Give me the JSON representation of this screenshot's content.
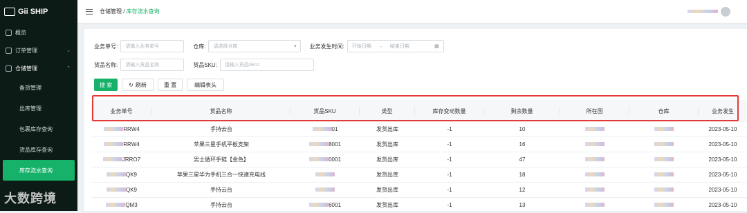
{
  "app": {
    "name": "Gii SHIP"
  },
  "sidebar": {
    "items": [
      {
        "label": "概览"
      },
      {
        "label": "订单管理"
      },
      {
        "label": "仓储管理"
      }
    ],
    "sub_items": [
      {
        "label": "备货管理"
      },
      {
        "label": "出库管理"
      },
      {
        "label": "包裹库存查询"
      },
      {
        "label": "货品库存查询"
      },
      {
        "label": "库存流水查询"
      }
    ]
  },
  "header": {
    "breadcrumb_parent": "仓储管理",
    "breadcrumb_sep": " / ",
    "breadcrumb_current": "库存流水查询"
  },
  "filters": {
    "order_no_label": "业务单号:",
    "order_no_placeholder": "请输入业务单号",
    "warehouse_label": "仓库:",
    "warehouse_placeholder": "请选择仓库",
    "time_label": "业务发生时间:",
    "start_placeholder": "开始日期",
    "range_sep": "→",
    "end_placeholder": "结束日期",
    "goods_name_label": "货品名称:",
    "goods_name_placeholder": "请输入货品名称",
    "sku_label": "货品SKU:",
    "sku_placeholder": "请输入货品SKU"
  },
  "actions": {
    "search": "搜 索",
    "refresh": "刷新",
    "reset": "重 置",
    "edit_header": "编辑表头"
  },
  "table": {
    "columns": [
      "业务单号",
      "货品名称",
      "货品SKU",
      "类型",
      "库存变动数量",
      "剩余数量",
      "所在国",
      "仓库",
      "业务发生"
    ],
    "rows": [
      {
        "order": "RRW4",
        "name": "手持云台",
        "sku": "01",
        "type": "发货出库",
        "change": "-1",
        "remain": "10",
        "date": "2023-05-10"
      },
      {
        "order": "RRW4",
        "name": "苹果三星手机平板支架",
        "sku": "8001",
        "type": "发货出库",
        "change": "-1",
        "remain": "16",
        "date": "2023-05-10"
      },
      {
        "order": "JRRO7",
        "name": "男士循环手链【金色】",
        "sku": "0001",
        "type": "发货出库",
        "change": "-1",
        "remain": "47",
        "date": "2023-05-10"
      },
      {
        "order": "QK9",
        "name": "苹果三星华为手机三合一快速充电线",
        "sku": "",
        "type": "发货出库",
        "change": "-1",
        "remain": "18",
        "date": "2023-05-10"
      },
      {
        "order": "QK9",
        "name": "手持云台",
        "sku": "",
        "type": "发货出库",
        "change": "-1",
        "remain": "12",
        "date": "2023-05-10"
      },
      {
        "order": "QM3",
        "name": "手持云台",
        "sku": "6001",
        "type": "发货出库",
        "change": "-1",
        "remain": "13",
        "date": "2023-05-10"
      }
    ]
  },
  "watermark": "大数跨境"
}
